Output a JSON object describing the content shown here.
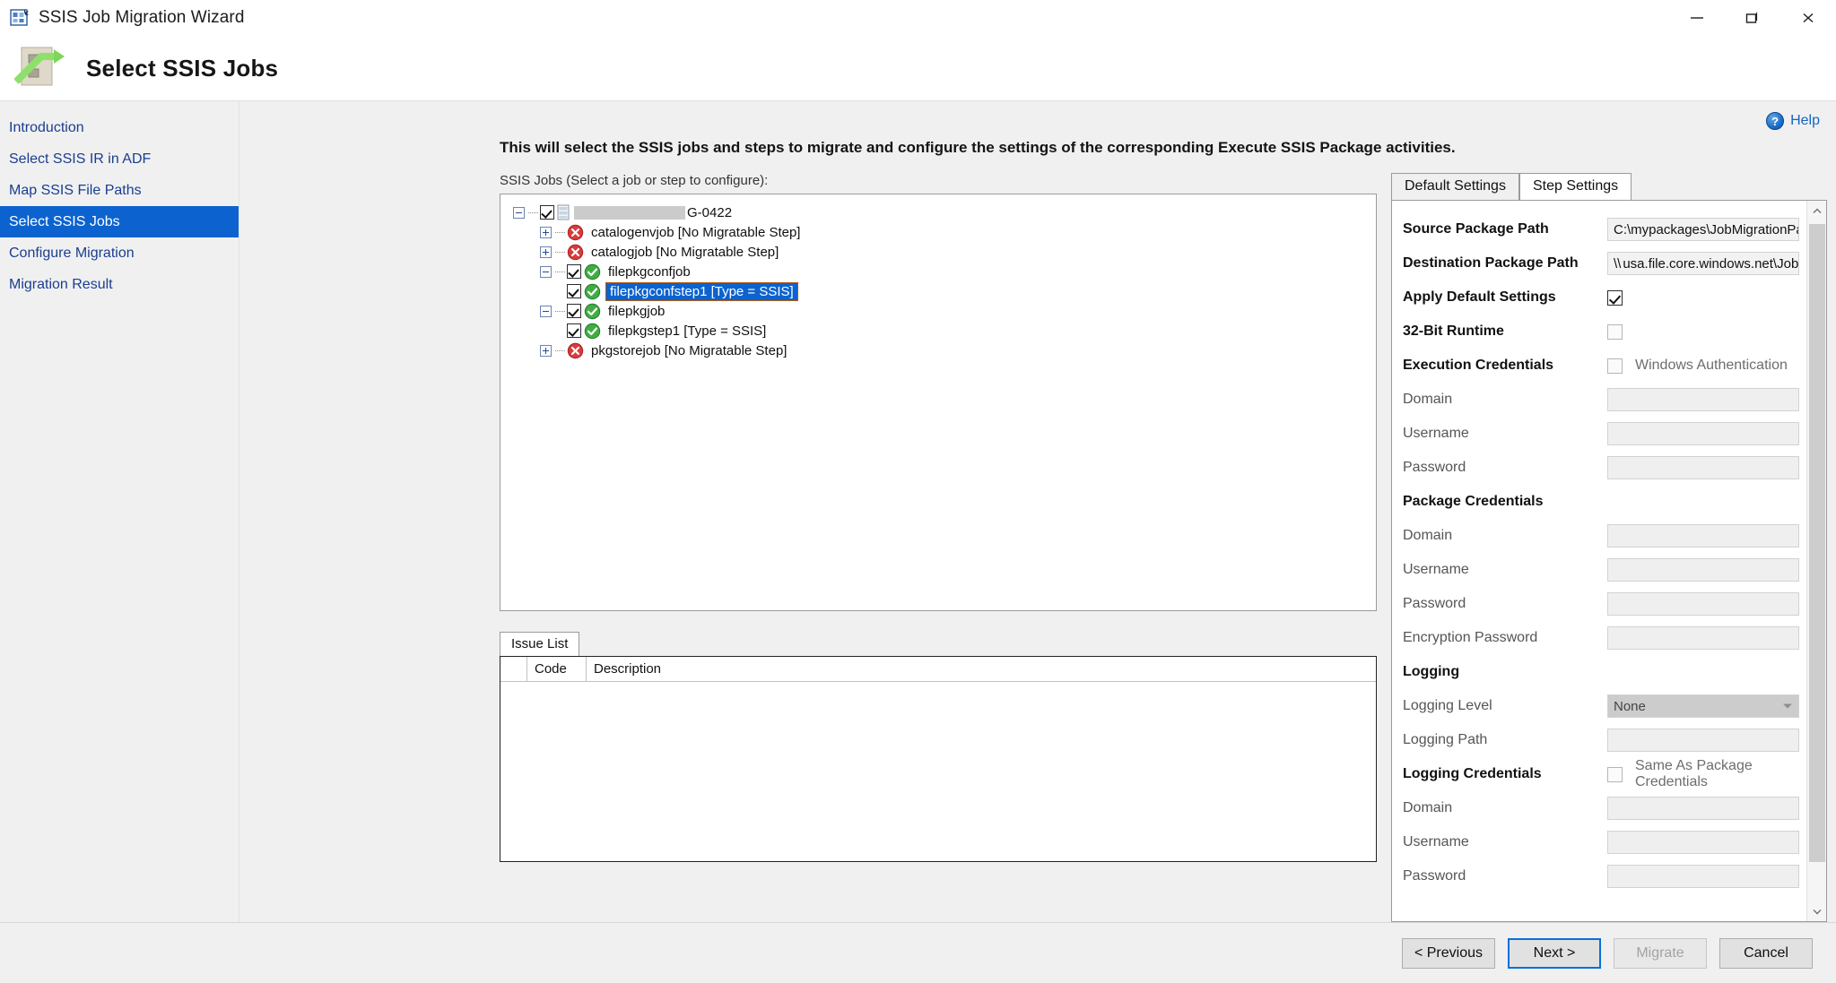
{
  "window": {
    "title": "SSIS Job Migration Wizard",
    "icon": "wizard-icon",
    "controls": {
      "minimize": "—",
      "maximize": "❐",
      "close": "✕"
    }
  },
  "header": {
    "title": "Select SSIS Jobs",
    "icon": "ssis-package-icon"
  },
  "sidebar": {
    "items": [
      {
        "label": "Introduction",
        "selected": false
      },
      {
        "label": "Select SSIS IR in ADF",
        "selected": false
      },
      {
        "label": "Map SSIS File Paths",
        "selected": false
      },
      {
        "label": "Select SSIS Jobs",
        "selected": true
      },
      {
        "label": "Configure Migration",
        "selected": false
      },
      {
        "label": "Migration Result",
        "selected": false
      }
    ]
  },
  "help": {
    "label": "Help",
    "icon": "help-circle-icon"
  },
  "main": {
    "intro": "This will select the SSIS jobs and steps to migrate and configure the settings of the corresponding Execute SSIS Package activities.",
    "tree_label": "SSIS Jobs (Select a job or step to configure):"
  },
  "tree": {
    "nodes": [
      {
        "id": "root",
        "level": 0,
        "expander": "minus",
        "checkbox": "checked",
        "icon": "server-icon",
        "redacted": true,
        "label": "G-0422",
        "selected": false
      },
      {
        "id": "catalogenvjob",
        "level": 1,
        "expander": "plus",
        "checkbox": "none",
        "icon": "error-icon",
        "redacted": false,
        "label": "catalogenvjob [No Migratable Step]",
        "selected": false
      },
      {
        "id": "catalogjob",
        "level": 1,
        "expander": "plus",
        "checkbox": "none",
        "icon": "error-icon",
        "redacted": false,
        "label": "catalogjob [No Migratable Step]",
        "selected": false
      },
      {
        "id": "filepkgconfjob",
        "level": 1,
        "expander": "minus",
        "checkbox": "checked",
        "icon": "success-icon",
        "redacted": false,
        "label": "filepkgconfjob",
        "selected": false
      },
      {
        "id": "filepkgconfstep1",
        "level": 2,
        "expander": "none",
        "checkbox": "checked",
        "icon": "success-icon",
        "redacted": false,
        "label": "filepkgconfstep1 [Type = SSIS]",
        "selected": true
      },
      {
        "id": "filepkgjob",
        "level": 1,
        "expander": "minus",
        "checkbox": "checked",
        "icon": "success-icon",
        "redacted": false,
        "label": "filepkgjob",
        "selected": false
      },
      {
        "id": "filepkgstep1",
        "level": 2,
        "expander": "none",
        "checkbox": "checked",
        "icon": "success-icon",
        "redacted": false,
        "label": "filepkgstep1 [Type = SSIS]",
        "selected": false
      },
      {
        "id": "pkgstorejob",
        "level": 1,
        "expander": "plus",
        "checkbox": "none",
        "icon": "error-icon",
        "redacted": false,
        "label": "pkgstorejob [No Migratable Step]",
        "selected": false
      }
    ]
  },
  "issue_list": {
    "tab_label": "Issue List",
    "columns": [
      "",
      "Code",
      "Description"
    ],
    "rows": []
  },
  "settings": {
    "tabs": [
      {
        "label": "Default Settings",
        "active": false
      },
      {
        "label": "Step Settings",
        "active": true
      }
    ],
    "rows": [
      {
        "kind": "text",
        "label": "Source Package Path",
        "bold": true,
        "value": "C:\\mypackages\\JobMigrationPackageFolder\\billingaggConfig.dtsx",
        "redacted": false
      },
      {
        "kind": "text",
        "label": "Destination Package Path",
        "bold": true,
        "value_prefix": "\\\\",
        "redacted": true,
        "value": "usa.file.core.windows.net\\JobMigrationPackageFolder\\JobMigrat"
      },
      {
        "kind": "checkbox",
        "label": "Apply Default Settings",
        "bold": true,
        "checked": true,
        "disabled": false,
        "caption": ""
      },
      {
        "kind": "checkbox",
        "label": "32-Bit Runtime",
        "bold": true,
        "checked": false,
        "disabled": true,
        "caption": ""
      },
      {
        "kind": "checkbox",
        "label": "Execution Credentials",
        "bold": true,
        "checked": false,
        "disabled": true,
        "caption": "Windows Authentication"
      },
      {
        "kind": "text",
        "label": "Domain",
        "bold": false,
        "value": ""
      },
      {
        "kind": "text",
        "label": "Username",
        "bold": false,
        "value": ""
      },
      {
        "kind": "text",
        "label": "Password",
        "bold": false,
        "value": ""
      },
      {
        "kind": "heading",
        "label": "Package Credentials",
        "bold": true
      },
      {
        "kind": "text",
        "label": "Domain",
        "bold": false,
        "value": ""
      },
      {
        "kind": "text",
        "label": "Username",
        "bold": false,
        "value": ""
      },
      {
        "kind": "text",
        "label": "Password",
        "bold": false,
        "value": ""
      },
      {
        "kind": "text",
        "label": "Encryption Password",
        "bold": false,
        "value": ""
      },
      {
        "kind": "heading",
        "label": "Logging",
        "bold": true
      },
      {
        "kind": "combo",
        "label": "Logging Level",
        "bold": false,
        "value": "None"
      },
      {
        "kind": "text",
        "label": "Logging Path",
        "bold": false,
        "value": ""
      },
      {
        "kind": "checkbox",
        "label": "Logging Credentials",
        "bold": true,
        "checked": false,
        "disabled": true,
        "caption": "Same As Package Credentials"
      },
      {
        "kind": "text",
        "label": "Domain",
        "bold": false,
        "value": ""
      },
      {
        "kind": "text",
        "label": "Username",
        "bold": false,
        "value": ""
      },
      {
        "kind": "text",
        "label": "Password",
        "bold": false,
        "value": ""
      }
    ],
    "scrollbar": {
      "up": "▲",
      "down": "▼"
    }
  },
  "footer": {
    "buttons": [
      {
        "label": "< Previous",
        "state": "normal"
      },
      {
        "label": "Next >",
        "state": "default"
      },
      {
        "label": "Migrate",
        "state": "disabled"
      },
      {
        "label": "Cancel",
        "state": "normal"
      }
    ]
  }
}
